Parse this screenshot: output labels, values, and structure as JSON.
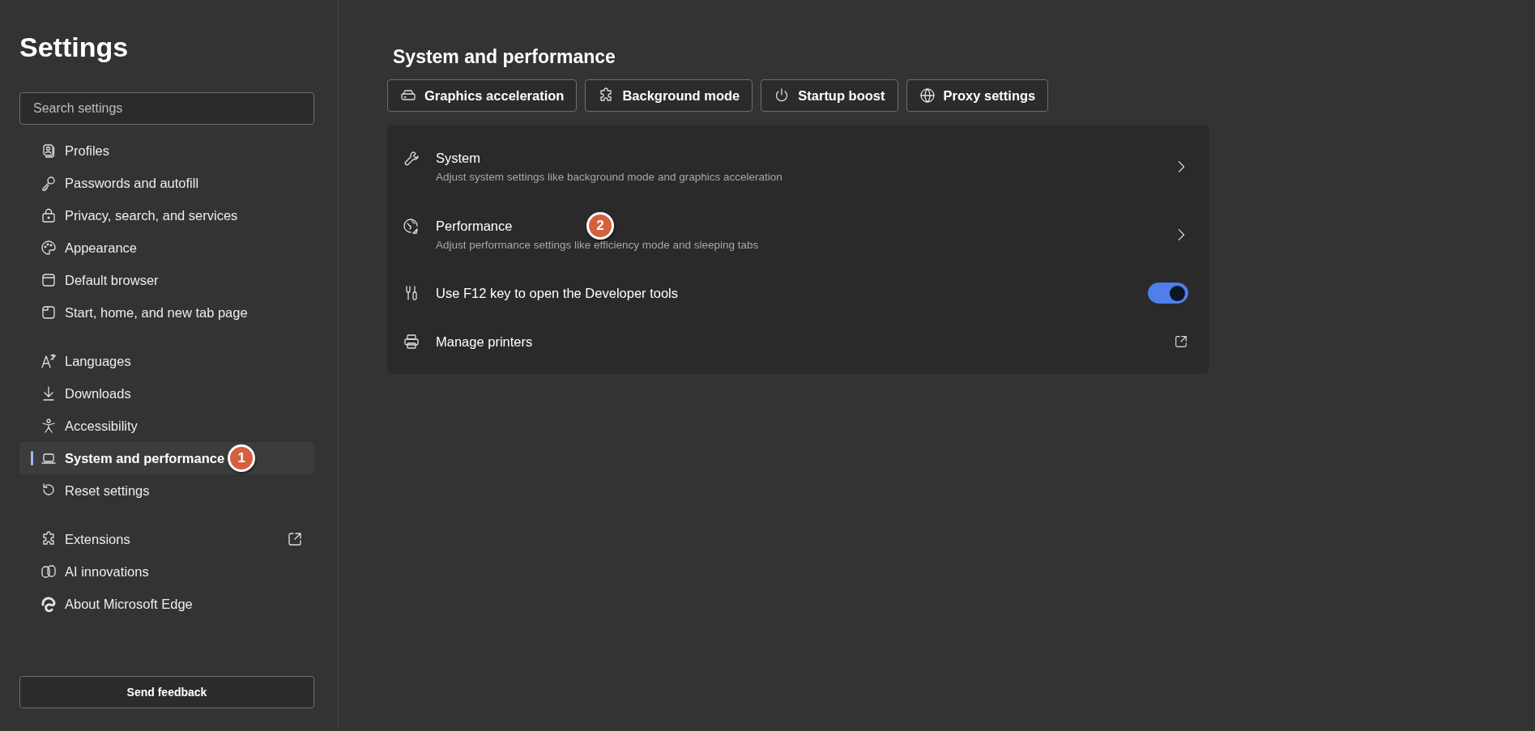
{
  "sidebar": {
    "title": "Settings",
    "search": {
      "placeholder": "Search settings"
    },
    "groups": [
      {
        "items": [
          {
            "label": "Profiles",
            "selected": false,
            "kind": "page"
          },
          {
            "label": "Passwords and autofill",
            "selected": false,
            "kind": "page"
          },
          {
            "label": "Privacy, search, and services",
            "selected": false,
            "kind": "page"
          },
          {
            "label": "Appearance",
            "selected": false,
            "kind": "page"
          },
          {
            "label": "Default browser",
            "selected": false,
            "kind": "page"
          },
          {
            "label": "Start, home, and new tab page",
            "selected": false,
            "kind": "page"
          }
        ]
      },
      {
        "items": [
          {
            "label": "Languages",
            "selected": false,
            "kind": "page"
          },
          {
            "label": "Downloads",
            "selected": false,
            "kind": "page"
          },
          {
            "label": "Accessibility",
            "selected": false,
            "kind": "page"
          },
          {
            "label": "System and performance",
            "selected": true,
            "kind": "page",
            "badge": "1"
          },
          {
            "label": "Reset settings",
            "selected": false,
            "kind": "page"
          }
        ]
      },
      {
        "items": [
          {
            "label": "Extensions",
            "selected": false,
            "kind": "external"
          },
          {
            "label": "AI innovations",
            "selected": false,
            "kind": "page"
          },
          {
            "label": "About Microsoft Edge",
            "selected": false,
            "kind": "page"
          }
        ]
      }
    ],
    "feedback_button": "Send feedback"
  },
  "main": {
    "heading": "System and performance",
    "quick_links": [
      "Graphics acceleration",
      "Background mode",
      "Startup boost",
      "Proxy settings"
    ],
    "rows": [
      {
        "kind": "nav",
        "title": "System",
        "description": "Adjust system settings like background mode and graphics acceleration"
      },
      {
        "kind": "nav",
        "title": "Performance",
        "description": "Adjust performance settings like efficiency mode and sleeping tabs",
        "badge": "2"
      },
      {
        "kind": "toggle",
        "title": "Use F12 key to open the Developer tools",
        "on": true
      },
      {
        "kind": "external",
        "title": "Manage printers"
      }
    ]
  }
}
